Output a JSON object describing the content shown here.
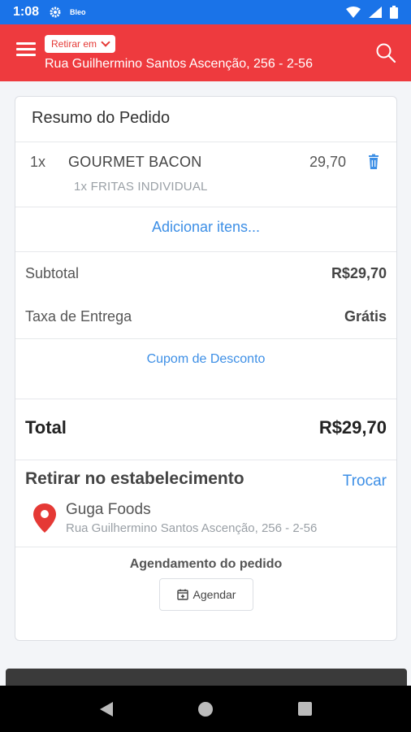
{
  "status_bar": {
    "time": "1:08",
    "app_badge": "Bleo",
    "icons": [
      "gear-icon",
      "wifi-icon",
      "signal-icon",
      "battery-icon"
    ]
  },
  "app_bar": {
    "mode_label": "Retirar em",
    "address": "Rua Guilhermino Santos Ascenção, 256 - 2-56",
    "icons": [
      "menu-icon",
      "chevron-down-icon",
      "search-icon"
    ]
  },
  "order": {
    "title": "Resumo do Pedido",
    "items": [
      {
        "qty": "1x",
        "name": "GOURMET BACON",
        "price": "29,70",
        "sub": "1x FRITAS INDIVIDUAL"
      }
    ],
    "add_items": "Adicionar itens..."
  },
  "summary": {
    "subtotal_label": "Subtotal",
    "subtotal_value": "R$29,70",
    "delivery_label": "Taxa de Entrega",
    "delivery_value": "Grátis",
    "coupon_label": "Cupom de Desconto",
    "total_label": "Total",
    "total_value": "R$29,70"
  },
  "pickup": {
    "title": "Retirar no estabelecimento",
    "change_label": "Trocar",
    "store_name": "Guga Foods",
    "store_address": "Rua Guilhermino Santos Ascenção, 256 - 2-56"
  },
  "schedule": {
    "title": "Agendamento do pedido",
    "button_label": "Agendar"
  },
  "colors": {
    "app_bar": "#ee3a3e",
    "status_bar": "#1a73e8",
    "link": "#3d8fe6",
    "pin": "#e53935"
  }
}
